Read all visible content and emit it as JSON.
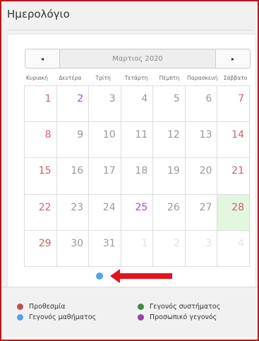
{
  "header": {
    "title": "Ημερολόγιο"
  },
  "calendar": {
    "month_label": "Μαρτιος 2020",
    "prev_glyph": "◂",
    "next_glyph": "▸",
    "weekdays": [
      "Κυριακή",
      "Δευτέρα",
      "Τρίτη",
      "Τετάρτη",
      "Πέμπτη",
      "Παρασκευή",
      "Σάββατο"
    ],
    "days": [
      "1",
      "2",
      "3",
      "4",
      "5",
      "6",
      "7",
      "8",
      "9",
      "10",
      "11",
      "12",
      "13",
      "14",
      "15",
      "16",
      "17",
      "18",
      "19",
      "20",
      "21",
      "22",
      "23",
      "24",
      "25",
      "26",
      "27",
      "28",
      "29",
      "30",
      "31",
      "1",
      "2",
      "3",
      "4"
    ]
  },
  "legend": {
    "deadline": "Προθεσμία",
    "system_event": "Γεγονός συστήματος",
    "course_event": "Γεγονός μαθήματος",
    "personal_event": "Προσωπικό γεγονός"
  },
  "colors": {
    "deadline": "#c0504d",
    "system_event": "#3e8f3e",
    "course_event": "#4da3f2",
    "personal_event": "#9b3fb5",
    "today_bg": "#e3f6df",
    "annotation_arrow": "#e3141b"
  }
}
